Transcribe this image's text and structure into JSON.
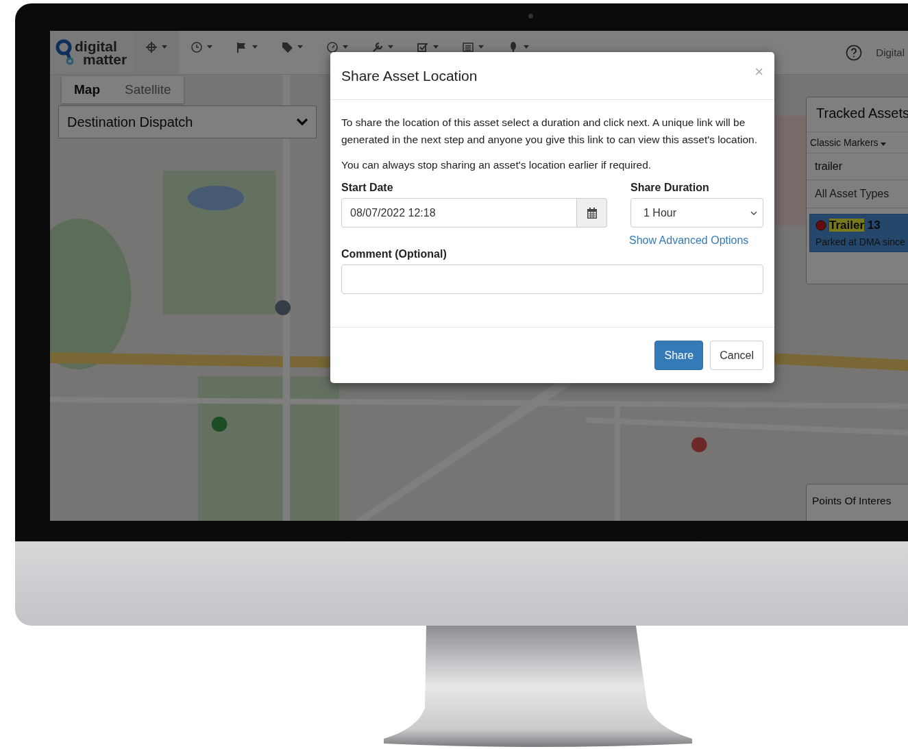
{
  "header": {
    "logo": [
      "digital",
      "matter"
    ],
    "toolbar": [
      {
        "kind": "crosshair"
      },
      {
        "kind": "clock"
      },
      {
        "kind": "flag"
      },
      {
        "kind": "tag"
      },
      {
        "kind": "gauge"
      },
      {
        "kind": "wrench"
      },
      {
        "kind": "check"
      },
      {
        "kind": "list"
      },
      {
        "kind": "pin"
      }
    ],
    "user": "Digital"
  },
  "map": {
    "type_tabs": [
      {
        "label": "Map",
        "selected": true
      },
      {
        "label": "Satellite",
        "selected": false
      }
    ],
    "group_select": {
      "value": "Destination Dispatch"
    }
  },
  "tracked_assets": {
    "title": "Tracked Assets",
    "marker_style": "Classic Markers",
    "search": {
      "value": "trailer"
    },
    "type_filter": "All Asset Types",
    "assets": [
      {
        "match": "Trailer",
        "rest": "13",
        "status": "Parked at DMA since",
        "selected": true
      }
    ]
  },
  "points_of_interest": {
    "title": "Points Of Interes"
  },
  "modal": {
    "title": "Share Asset Location",
    "close": "×",
    "paragraphs": [
      "To share the location of this asset select a duration and click next. A unique link will be generated in the next step and anyone you give this link to can view this asset's location.",
      "You can always stop sharing an asset's location earlier if required."
    ],
    "start_date": {
      "label": "Start Date",
      "value": "08/07/2022 12:18"
    },
    "share_duration": {
      "label": "Share Duration",
      "value": "1 Hour"
    },
    "advanced_link": "Show Advanced Options",
    "comment": {
      "label": "Comment (Optional)"
    },
    "buttons": [
      {
        "label": "Share",
        "kind": "primary"
      },
      {
        "label": "Cancel",
        "kind": "default"
      }
    ]
  }
}
